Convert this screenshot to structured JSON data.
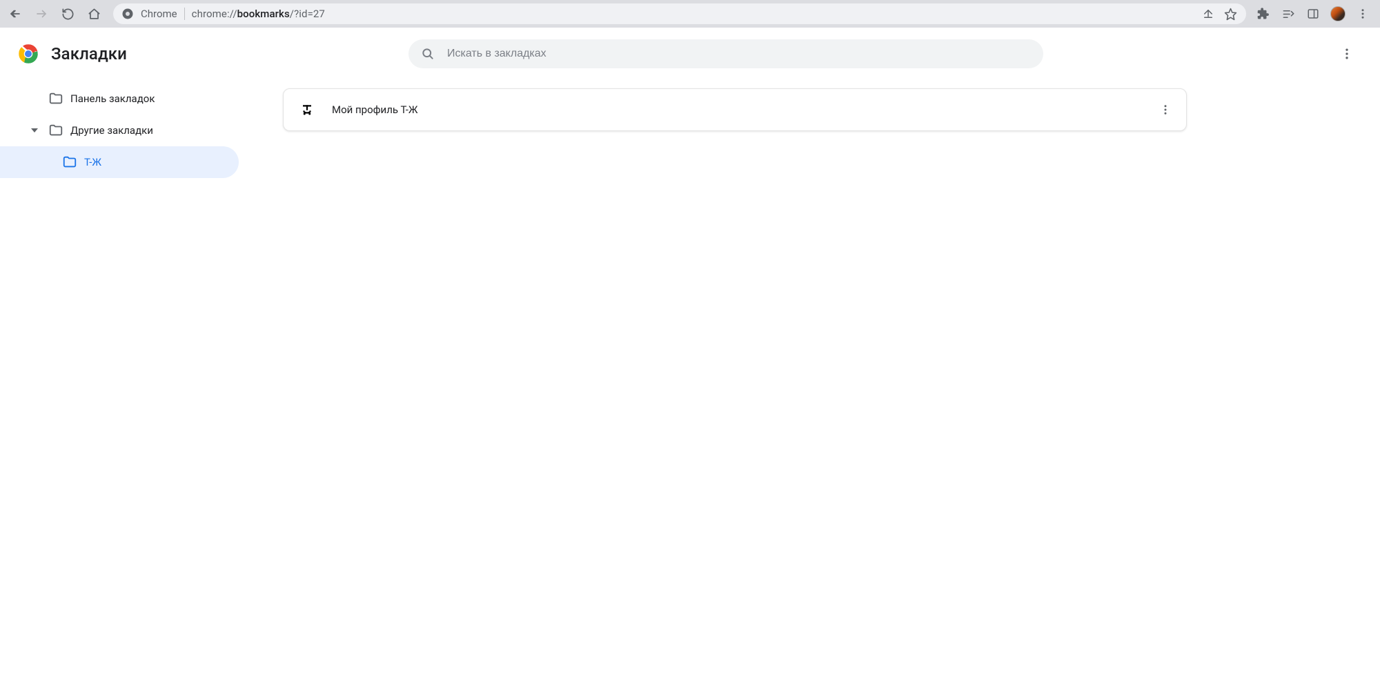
{
  "browser": {
    "address_label": "Chrome",
    "url_prefix": "chrome://",
    "url_bold": "bookmarks",
    "url_suffix": "/?id=27"
  },
  "header": {
    "title": "Закладки",
    "search_placeholder": "Искать в закладках"
  },
  "sidebar": {
    "items": [
      {
        "label": "Панель закладок",
        "level": 1,
        "expandable": false,
        "selected": false
      },
      {
        "label": "Другие закладки",
        "level": 1,
        "expandable": true,
        "expanded": true,
        "selected": false
      },
      {
        "label": "Т-Ж",
        "level": 2,
        "expandable": false,
        "selected": true
      }
    ]
  },
  "bookmarks": [
    {
      "title": "Мой профиль Т-Ж"
    }
  ]
}
